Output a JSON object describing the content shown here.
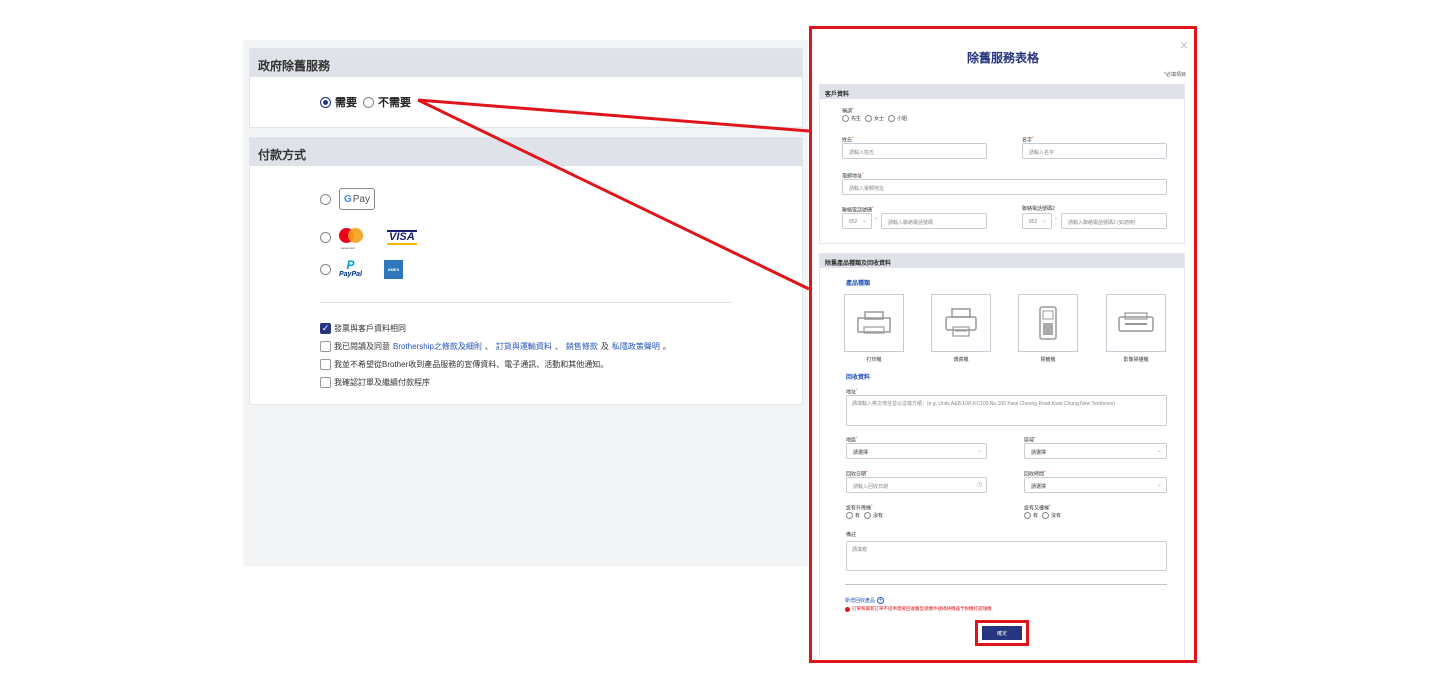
{
  "gov_service": {
    "title": "政府除舊服務",
    "options": [
      {
        "label": "需要",
        "selected": true
      },
      {
        "label": "不需要",
        "selected": false
      }
    ]
  },
  "payment": {
    "title": "付款方式",
    "methods": [
      {
        "icons": [
          "gpay-icon"
        ],
        "gpay_text": "Pay"
      },
      {
        "icons": [
          "mastercard-icon",
          "visa-icon"
        ],
        "visa_text": "VISA",
        "mastercard_text": "mastercard"
      },
      {
        "icons": [
          "paypal-icon",
          "amex-icon"
        ],
        "paypal_text": "PayPal",
        "amex_text": "AMEX"
      }
    ],
    "checks": [
      {
        "checked": true,
        "text": "發票與客戶資料相同"
      },
      {
        "checked": false,
        "pre": "我已閱讀及同意",
        "link1": "Brothership之條款及細則",
        "mid1": "、",
        "link2": "訂貨與運輸資料",
        "mid2": "、",
        "link3": "銷售條款",
        "mid3": "及",
        "link4": "私隱政策聲明",
        "post": "。"
      },
      {
        "checked": false,
        "text": "我並不希望從Brother收到產品服務的宣傳資料、電子通訊、活動和其他通知。"
      },
      {
        "checked": false,
        "text": "我確認訂單及繼續付款程序"
      }
    ]
  },
  "modal": {
    "title": "除舊服務表格",
    "close": "×",
    "required_note": "*必填項目",
    "customer": {
      "head": "客戶資料",
      "title_label": "稱謂",
      "title_options": [
        "先生",
        "女士",
        "小姐"
      ],
      "surname_label": "姓氏",
      "surname_ph": "請輸入姓氏",
      "name_label": "名字",
      "name_ph": "請輸入名字",
      "email_label": "電郵地址",
      "email_ph": "請輸入電郵地址",
      "phone_label": "聯絡電話號碼",
      "phone_code": "852",
      "phone_ph": "請輸入聯絡電話號碼",
      "phone2_label": "聯絡電話號碼2",
      "phone2_code": "852",
      "phone2_ph": "請輸入聯絡電話號碼2 (如適用)"
    },
    "recycle": {
      "head": "除舊產品種類及回收資料",
      "product_type_label": "產品種類",
      "products": [
        "打印機",
        "傳真機",
        "標籤機",
        "影像掃描機"
      ],
      "info_label": "回收資料",
      "address_label": "地址",
      "address_ph": "請填輸入英文地址並以這樣方順：(e.g. Units A&B,10/F,KC100,No.100 Kwai Cheong Road,Kwai Chung,New Territories)",
      "region_label": "地區",
      "region_ph": "請選擇",
      "district_label": "區域",
      "district_ph": "請選擇",
      "date_label": "回收日期",
      "date_ph": "請輸入回收日期",
      "time_label": "回收時間",
      "time_ph": "請選擇",
      "lift_label": "設有升降機",
      "lift_options": [
        "有",
        "沒有"
      ],
      "stairs_label": "設有又樓梯",
      "stairs_options": [
        "有",
        "沒有"
      ],
      "remark_label": "備註",
      "remark_ph": "請填寫"
    },
    "add_more": "新增回收產品",
    "warning": "訂單和最新訂單不提供需要回收舊型號機件號碼將機器予製機打認隨機",
    "submit": "確定"
  },
  "colors": {
    "accent": "#27347f",
    "callout": "#e0141a",
    "link": "#2553b8"
  }
}
